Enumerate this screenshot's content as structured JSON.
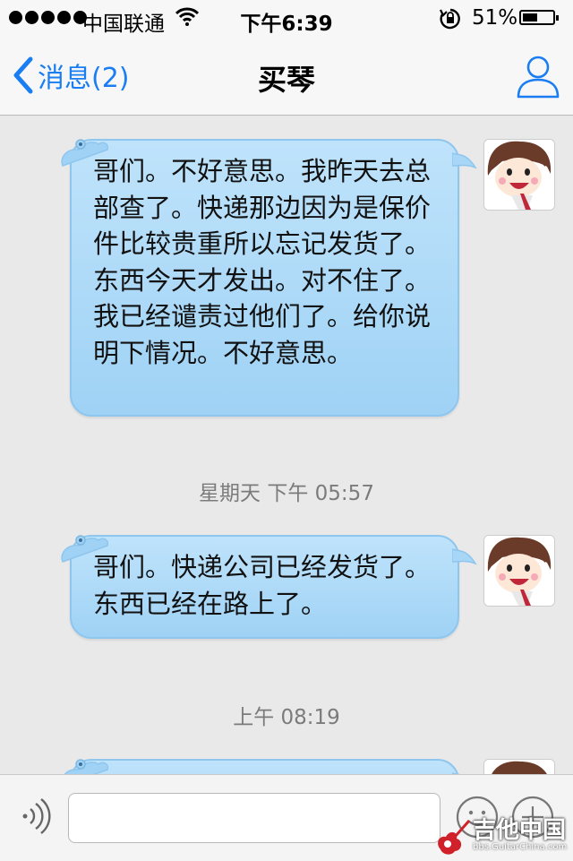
{
  "status_bar": {
    "carrier": "中国联通",
    "time": "下午6:39",
    "battery_percent": "51%",
    "battery_level": 0.51,
    "signal_bars": 5,
    "icons": [
      "signal-dots-icon",
      "wifi-icon",
      "rotation-lock-icon",
      "battery-icon"
    ]
  },
  "nav": {
    "back_label": "消息(2)",
    "title": "买琴",
    "icons": [
      "chevron-left-icon",
      "profile-icon"
    ]
  },
  "conversation": {
    "messages": [
      {
        "text": "哥们。不好意思。我昨天去总部查了。快递那边因为是保价件比较贵重所以忘记发货了。东西今天才发出。对不住了。我已经谴责过他们了。给你说明下情况。不好意思。"
      },
      {
        "timestamp": "星期天 下午 05:57"
      },
      {
        "text": "哥们。快递公司已经发货了。东西已经在路上了。"
      },
      {
        "timestamp": "上午 08:19"
      },
      {
        "text": ""
      }
    ]
  },
  "input_bar": {
    "value": "",
    "placeholder": "",
    "icons": [
      "voice-icon",
      "emoji-icon",
      "plus-icon"
    ]
  },
  "watermark": {
    "main": "吉他中国",
    "sub": "bbs.GuitarChina.com"
  },
  "colors": {
    "accent": "#1a7ef2",
    "bubble": "#aad8f7",
    "background": "#e9e9ea",
    "timestamp": "#7b7b7b"
  }
}
